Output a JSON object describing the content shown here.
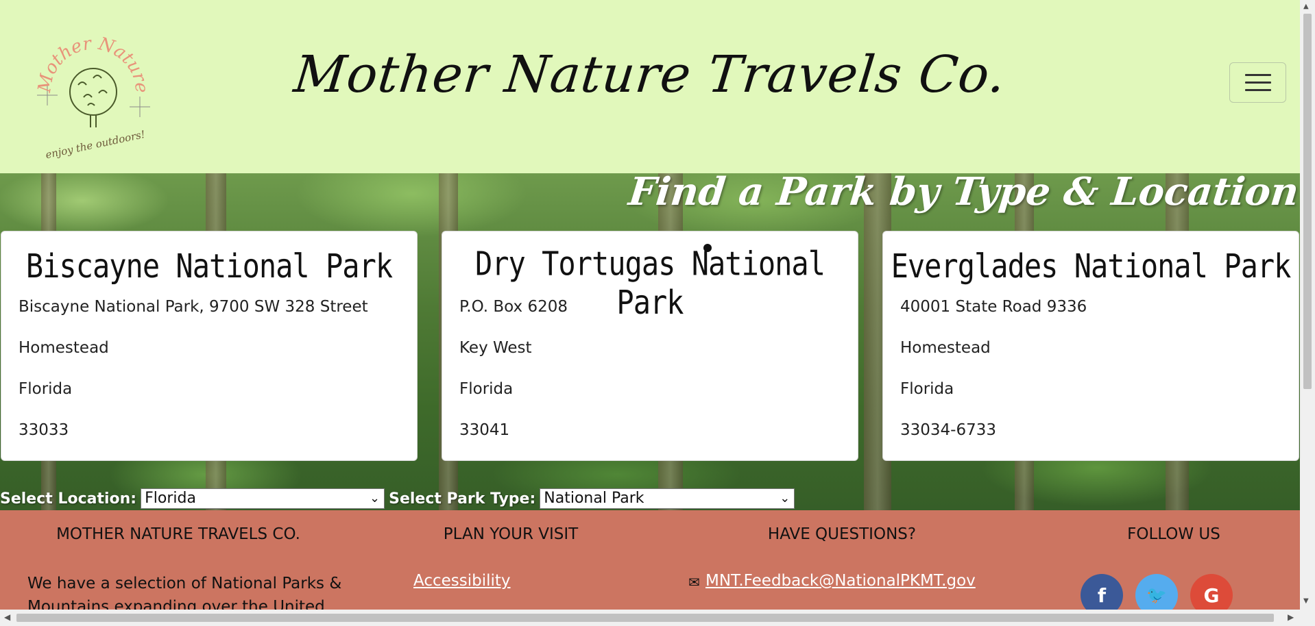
{
  "header": {
    "site_title": "Mother Nature Travels Co.",
    "logo": {
      "arc_text": "Mother Nature",
      "tagline": "enjoy the outdoors!"
    },
    "menu_icon": "hamburger-menu-icon"
  },
  "hero": {
    "heading": "Find a Park by Type & Location"
  },
  "parks": [
    {
      "name": "Biscayne National Park",
      "lines": [
        "Biscayne National Park, 9700 SW 328 Street",
        "Homestead",
        "Florida",
        "33033"
      ]
    },
    {
      "name": "Dry Tortugas National Park",
      "lines": [
        "P.O. Box 6208",
        "Key West",
        "Florida",
        "33041"
      ]
    },
    {
      "name": "Everglades National Park",
      "lines": [
        "40001 State Road 9336",
        "Homestead",
        "Florida",
        "33034-6733"
      ]
    }
  ],
  "filters": {
    "location_label": "Select Location:",
    "location_value": "Florida",
    "type_label": "Select Park Type:",
    "type_value": "National Park"
  },
  "footer": {
    "col1_heading": "MOTHER NATURE TRAVELS CO.",
    "col1_text": "We have a selection of National Parks & Mountains expanding over the United",
    "col2_heading": "PLAN YOUR VISIT",
    "col2_link": "Accessibility",
    "col3_heading": "HAVE QUESTIONS?",
    "col3_email": "MNT.Feedback@NationalPKMT.gov",
    "col4_heading": "FOLLOW US",
    "social": [
      {
        "icon": "facebook-icon",
        "glyph": "f",
        "color": "#3b5998"
      },
      {
        "icon": "twitter-icon",
        "glyph": "🐦",
        "color": "#55acee"
      },
      {
        "icon": "google-icon",
        "glyph": "G",
        "color": "#dd4b39"
      }
    ]
  }
}
